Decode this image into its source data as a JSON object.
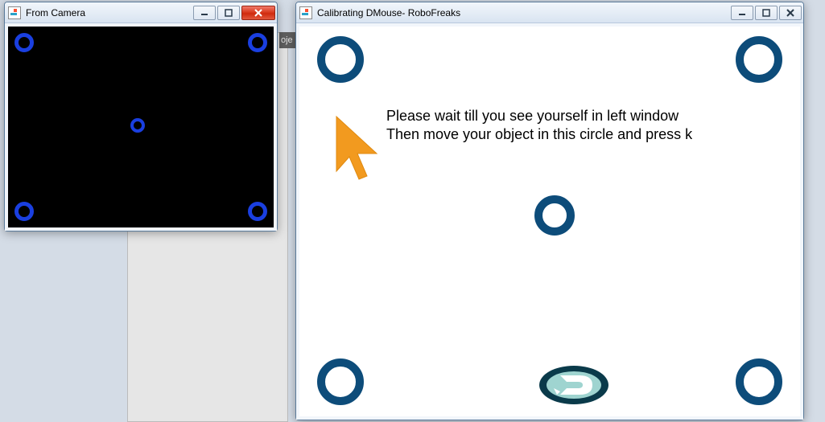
{
  "camera_window": {
    "title": "From Camera"
  },
  "calibrate_window": {
    "title": "Calibrating DMouse- RoboFreaks",
    "instruction_line1": "Please wait till you see yourself in left window",
    "instruction_line2": "Then move your object in this circle and press k"
  },
  "bg_tab_text": "oje",
  "colors": {
    "small_ring": "#1a3fe0",
    "large_ring": "#0d4c7a",
    "cursor": "#f29a1f"
  }
}
